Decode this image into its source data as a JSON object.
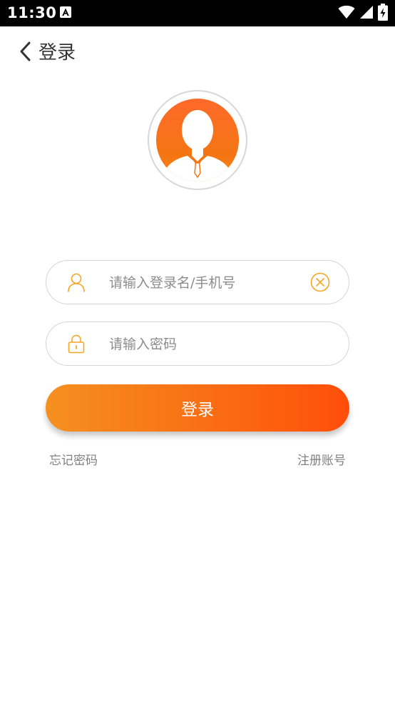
{
  "status_bar": {
    "time": "11:30",
    "icons": [
      "notification-a-icon",
      "wifi-icon",
      "signal-icon",
      "battery-icon"
    ]
  },
  "app_bar": {
    "back_icon": "chevron-left-icon",
    "title": "登录"
  },
  "avatar": {
    "icon": "user-avatar-icon"
  },
  "form": {
    "username": {
      "icon": "user-icon",
      "placeholder": "请输入登录名/手机号",
      "value": "",
      "clear_icon": "clear-circle-x-icon"
    },
    "password": {
      "icon": "lock-icon",
      "placeholder": "请输入密码",
      "value": ""
    },
    "login_label": "登录",
    "forgot_password_label": "忘记密码",
    "register_label": "注册账号"
  },
  "colors": {
    "accent": "#f7891f",
    "accent_end": "#ff4e0a",
    "icon_outline": "#f5a623",
    "status_bar_bg": "#000000",
    "text_title": "#333333",
    "text_muted": "#808080",
    "placeholder": "#8c8c8c"
  }
}
